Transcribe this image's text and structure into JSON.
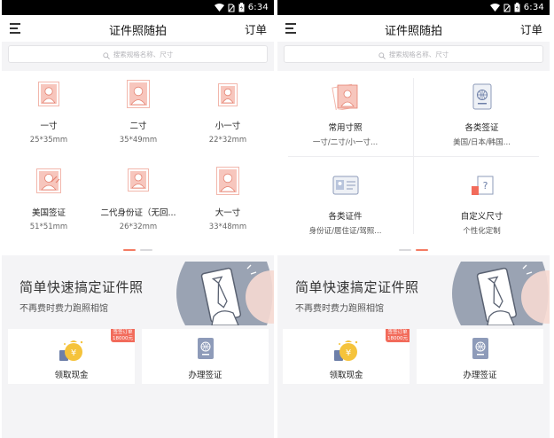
{
  "status": {
    "time": "6:34"
  },
  "appbar": {
    "title": "证件照随拍",
    "orders": "订单"
  },
  "search": {
    "placeholder": "搜索规格名称、尺寸"
  },
  "left_grid": [
    {
      "name": "一寸",
      "size": "25*35mm"
    },
    {
      "name": "二寸",
      "size": "35*49mm"
    },
    {
      "name": "小一寸",
      "size": "22*32mm"
    },
    {
      "name": "美国签证",
      "size": "51*51mm"
    },
    {
      "name": "二代身份证（无回...",
      "size": "26*32mm"
    },
    {
      "name": "大一寸",
      "size": "33*48mm"
    }
  ],
  "right_grid": [
    {
      "name": "常用寸照",
      "sub": "一寸/二寸/小一寸..."
    },
    {
      "name": "各类签证",
      "sub": "美国/日本/韩国..."
    },
    {
      "name": "各类证件",
      "sub": "身份证/居住证/驾照..."
    },
    {
      "name": "自定义尺寸",
      "sub": "个性化定制"
    }
  ],
  "banner": {
    "title": "简单快速搞定证件照",
    "subtitle": "不再费时费力跑照相馆"
  },
  "cards": {
    "cash": "领取现金",
    "visa": "办理签证",
    "badge_line1": "签签订单",
    "badge_line2": "18000元"
  },
  "colors": {
    "accent": "#f47b63",
    "banner_bg": "#9aa3b3"
  }
}
